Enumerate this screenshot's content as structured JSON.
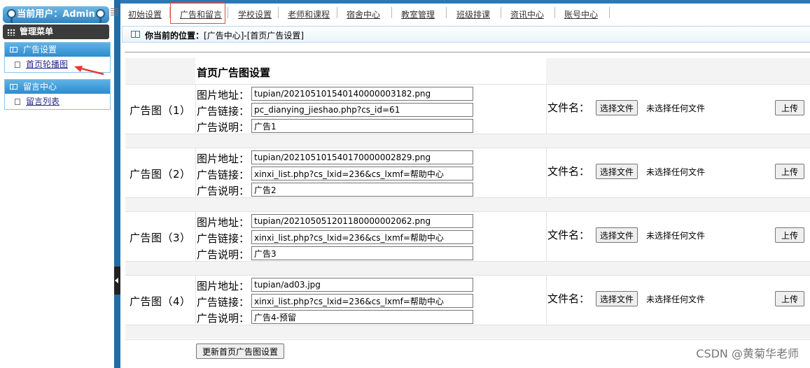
{
  "sidebar": {
    "user_label": "当前用户：Admin",
    "menu_title": "管理菜单",
    "groups": [
      {
        "title": "广告设置",
        "items": [
          {
            "label": "首页轮播图"
          }
        ]
      },
      {
        "title": "留言中心",
        "items": [
          {
            "label": "留言列表"
          }
        ]
      }
    ]
  },
  "topnav": {
    "items": [
      {
        "label": "初始设置"
      },
      {
        "label": "广告和留言"
      },
      {
        "label": "学校设置"
      },
      {
        "label": "老师和课程"
      },
      {
        "label": "宿舍中心"
      },
      {
        "label": "教室管理"
      },
      {
        "label": "班级排课"
      },
      {
        "label": "资讯中心"
      },
      {
        "label": "账号中心"
      }
    ],
    "highlighted": "广告和留言"
  },
  "breadcrumb": {
    "prefix": "你当前的位置：",
    "path": "[广告中心]-[首页广告设置]"
  },
  "form": {
    "title": "首页广告图设置",
    "field_labels": {
      "image": "图片地址：",
      "link": "广告链接：",
      "desc": "广告说明："
    },
    "file_label": "文件名：",
    "choose_button": "选择文件",
    "no_file_text": "未选择任何文件",
    "upload_button": "上传",
    "ads": [
      {
        "label": "广告图（1）",
        "image": "tupian/20210510154014000000 3182.png",
        "link": "pc_dianying_jieshao.php?cs_id=61",
        "desc": "广告1"
      },
      {
        "label": "广告图（2）",
        "image": "tupian/2021051015401700000 02829.png",
        "link": "xinxi_list.php?cs_lxid=236&cs_lxmf=帮助中心",
        "desc": "广告2"
      },
      {
        "label": "广告图（3）",
        "image": "tupian/2021050512011800000 02062.png",
        "link": "xinxi_list.php?cs_lxid=236&cs_lxmf=帮助中心",
        "desc": "广告3"
      },
      {
        "label": "广告图（4）",
        "image": "tupian/ad03.jpg",
        "link": "xinxi_list.php?cs_lxid=236&cs_lxmf=帮助中心",
        "desc": "广告4-预留"
      }
    ],
    "submit_button": "更新首页广告图设置"
  },
  "watermark": "CSDN @黄菊华老师",
  "colors": {
    "accent": "#2a78b5",
    "highlight_border": "#e04a4a",
    "arrow": "#e53935"
  }
}
